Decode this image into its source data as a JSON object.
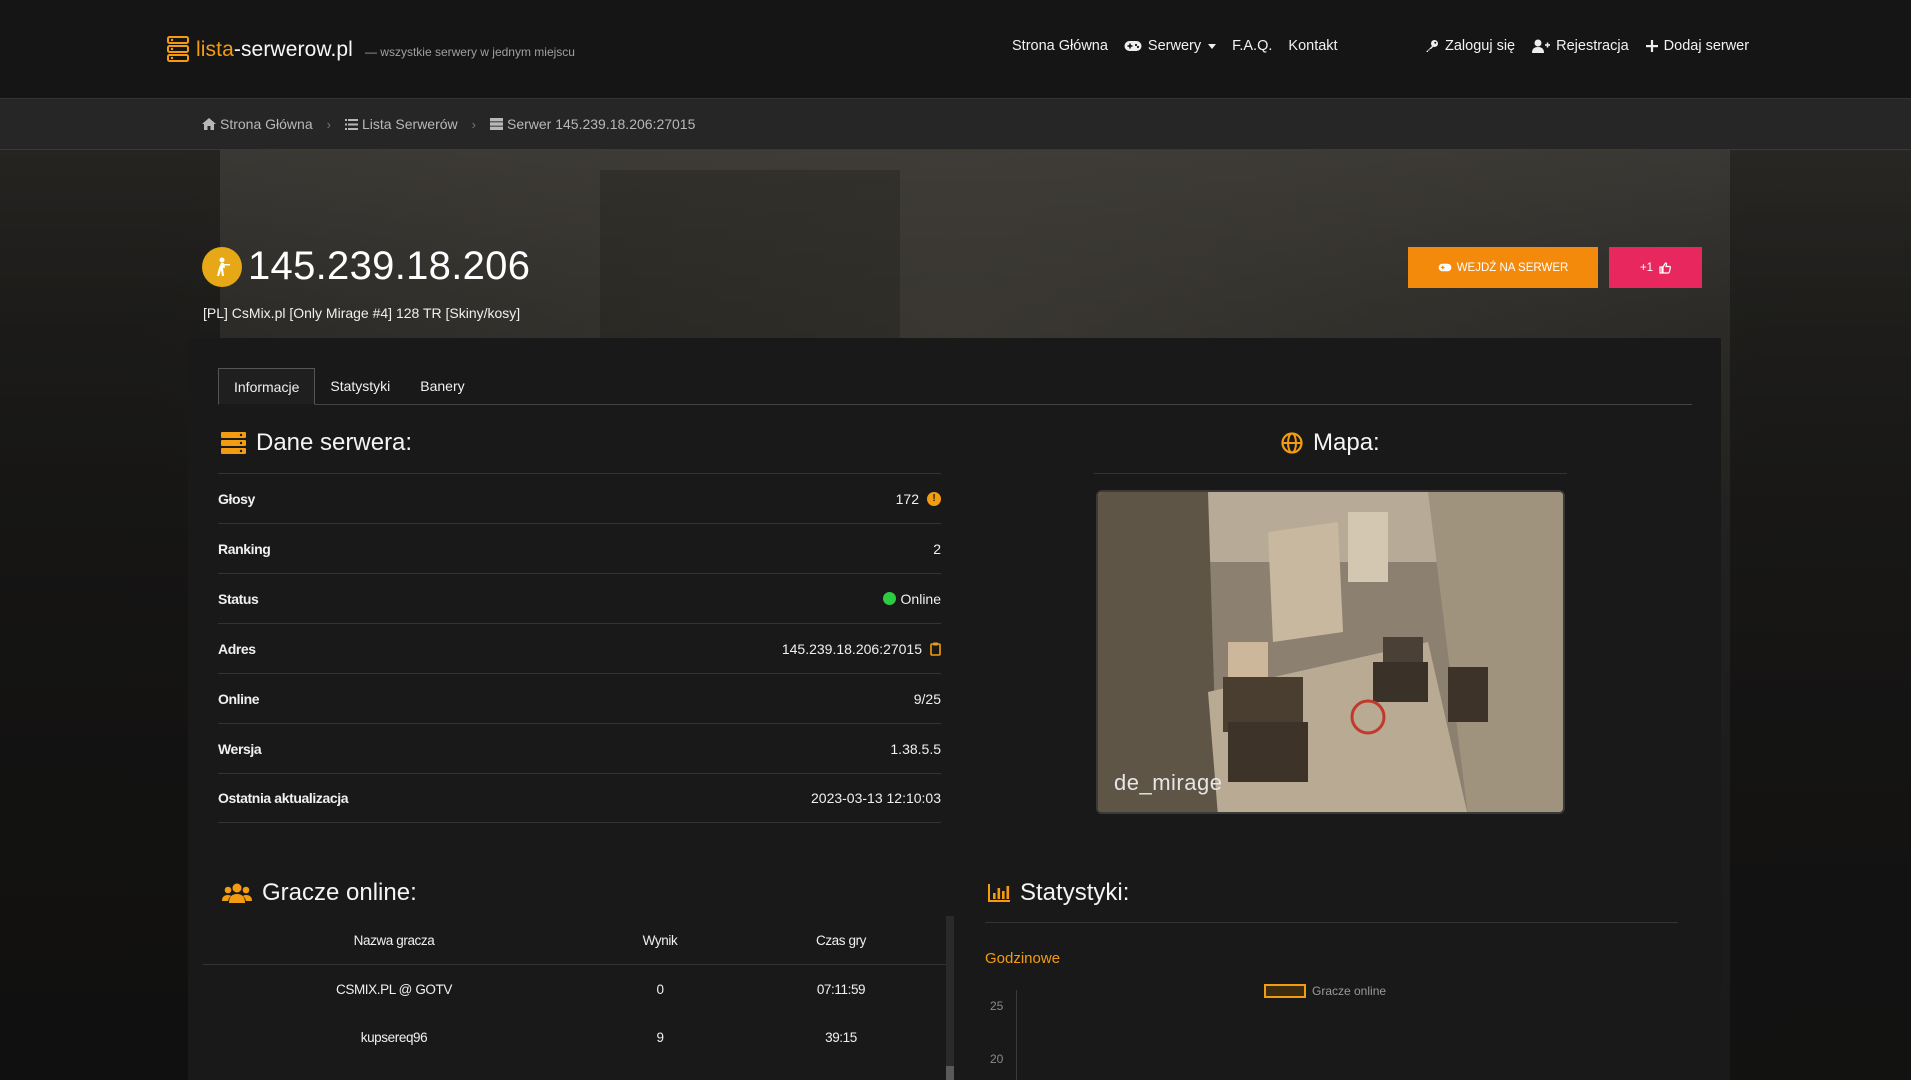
{
  "site": {
    "logo_main": "lista",
    "logo_accent": "-serwerow.pl",
    "tagline": "— wszystkie serwery w jednym miejscu"
  },
  "nav": {
    "home": "Strona Główna",
    "servers": "Serwery",
    "faq": "F.A.Q.",
    "contact": "Kontakt",
    "login": "Zaloguj się",
    "register": "Rejestracja",
    "add_server": "Dodaj serwer"
  },
  "breadcrumb": {
    "home": "Strona Główna",
    "list": "Lista Serwerów",
    "current": "Serwer 145.239.18.206:27015"
  },
  "server": {
    "ip": "145.239.18.206",
    "name": "[PL] CsMix.pl [Only Mirage #4] 128 TR [Skiny/kosy]",
    "join_label": "WEJDŹ NA SERWER",
    "vote_label": "+1"
  },
  "tabs": [
    "Informacje",
    "Statystyki",
    "Banery"
  ],
  "server_data": {
    "heading": "Dane serwera:",
    "rows": [
      {
        "label": "Głosy",
        "value": "172"
      },
      {
        "label": "Ranking",
        "value": "2"
      },
      {
        "label": "Status",
        "value": "Online"
      },
      {
        "label": "Adres",
        "value": "145.239.18.206:27015"
      },
      {
        "label": "Online",
        "value": "9/25"
      },
      {
        "label": "Wersja",
        "value": "1.38.5.5"
      },
      {
        "label": "Ostatnia aktualizacja",
        "value": "2023-03-13 12:10:03"
      }
    ]
  },
  "map": {
    "heading": "Mapa:",
    "name": "de_mirage"
  },
  "players": {
    "heading": "Gracze online:",
    "columns": [
      "Nazwa gracza",
      "Wynik",
      "Czas gry"
    ],
    "rows": [
      {
        "name": "CSMIX.PL @ GOTV",
        "score": "0",
        "time": "07:11:59"
      },
      {
        "name": "kupsereq96",
        "score": "9",
        "time": "39:15"
      }
    ]
  },
  "stats": {
    "heading": "Statystyki:",
    "subheading": "Godzinowe",
    "legend": "Gracze online",
    "y_ticks": [
      "25",
      "20"
    ]
  },
  "colors": {
    "accent": "#f39c12",
    "join_button": "#f48a0c",
    "vote_button": "#e8275f",
    "online": "#2ecc40"
  }
}
